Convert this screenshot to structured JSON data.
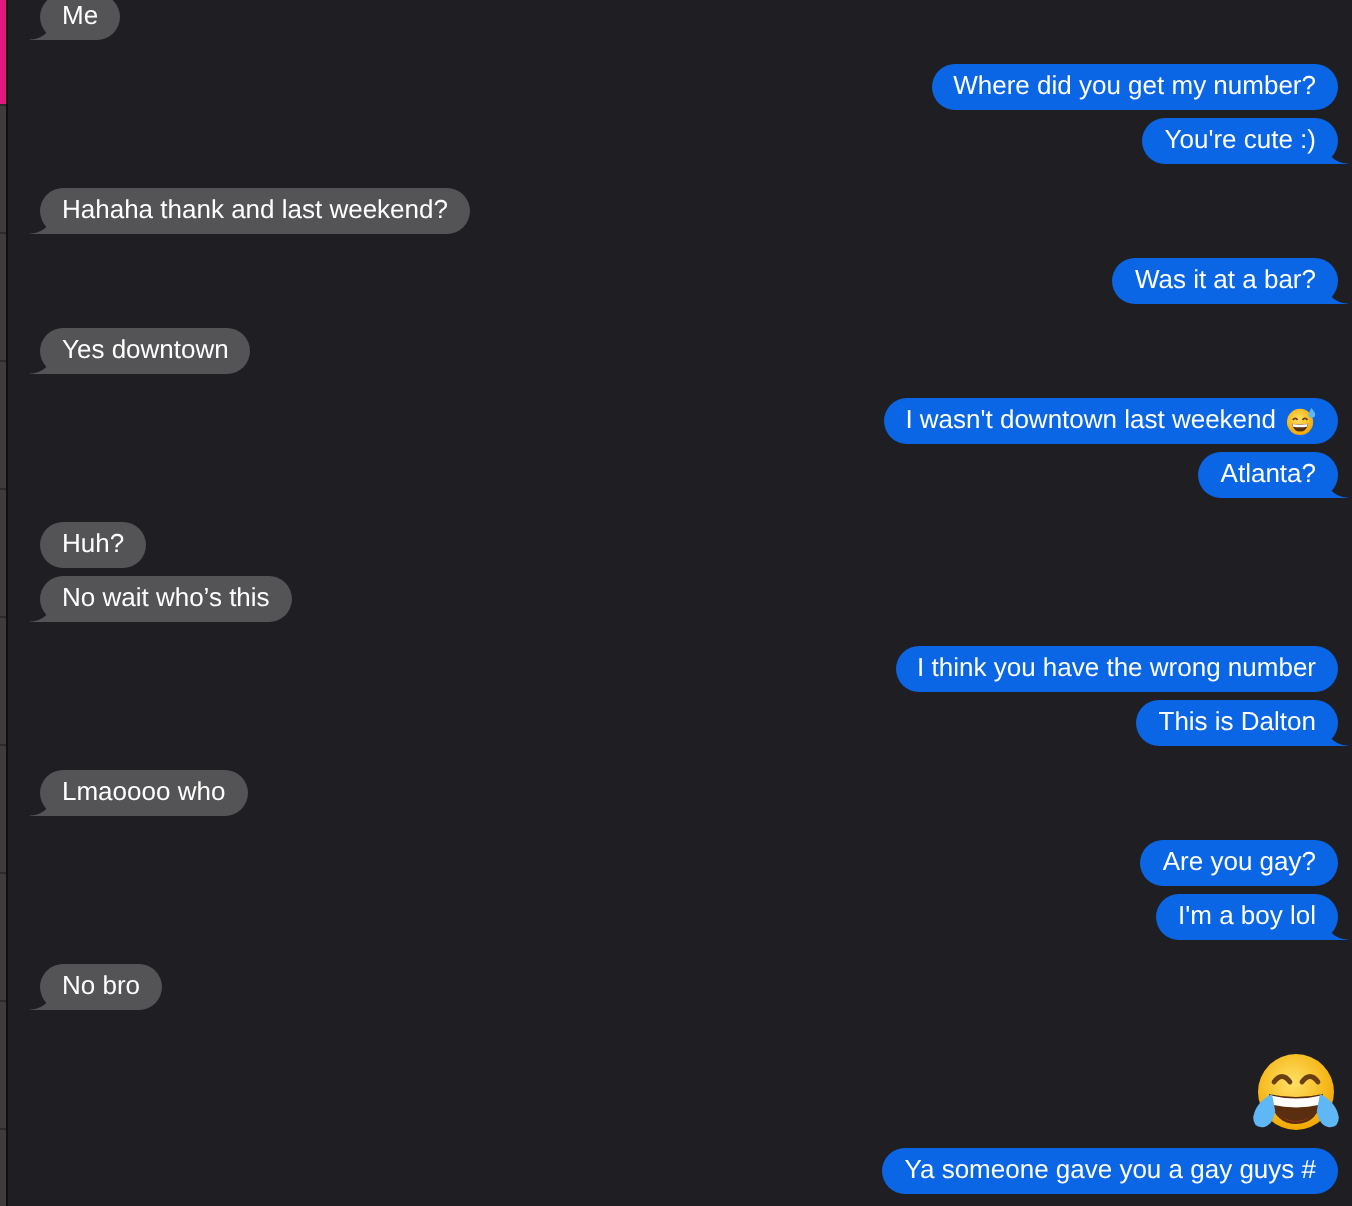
{
  "sidebar": {
    "items": [
      {
        "selected": true
      },
      {
        "selected": false
      },
      {
        "selected": false
      },
      {
        "selected": false
      },
      {
        "selected": false
      },
      {
        "selected": false
      },
      {
        "selected": false
      },
      {
        "selected": false
      },
      {
        "selected": false
      },
      {
        "selected": false
      }
    ]
  },
  "messages": [
    {
      "sent": false,
      "kind": "text",
      "text": "Me"
    },
    {
      "sent": true,
      "kind": "text",
      "text": "Where did you get my number?"
    },
    {
      "sent": true,
      "kind": "text",
      "text": "You're cute :)"
    },
    {
      "sent": false,
      "kind": "text",
      "text": "Hahaha thank and last weekend?"
    },
    {
      "sent": true,
      "kind": "text",
      "text": "Was it at a bar?"
    },
    {
      "sent": false,
      "kind": "text",
      "text": "Yes downtown"
    },
    {
      "sent": true,
      "kind": "text",
      "text": "I wasn't downtown last weekend",
      "trailing_emoji": true
    },
    {
      "sent": true,
      "kind": "text",
      "text": "Atlanta?"
    },
    {
      "sent": false,
      "kind": "text",
      "text": "Huh?"
    },
    {
      "sent": false,
      "kind": "text",
      "text": "No wait who’s this"
    },
    {
      "sent": true,
      "kind": "text",
      "text": "I think you have the wrong number"
    },
    {
      "sent": true,
      "kind": "text",
      "text": "This is Dalton"
    },
    {
      "sent": false,
      "kind": "text",
      "text": "Lmaoooo who"
    },
    {
      "sent": true,
      "kind": "text",
      "text": "Are you gay?"
    },
    {
      "sent": true,
      "kind": "text",
      "text": "I'm a boy lol"
    },
    {
      "sent": false,
      "kind": "text",
      "text": "No bro"
    },
    {
      "sent": true,
      "kind": "emoji"
    },
    {
      "sent": true,
      "kind": "text",
      "text": "Ya someone gave you a gay guys #"
    }
  ]
}
